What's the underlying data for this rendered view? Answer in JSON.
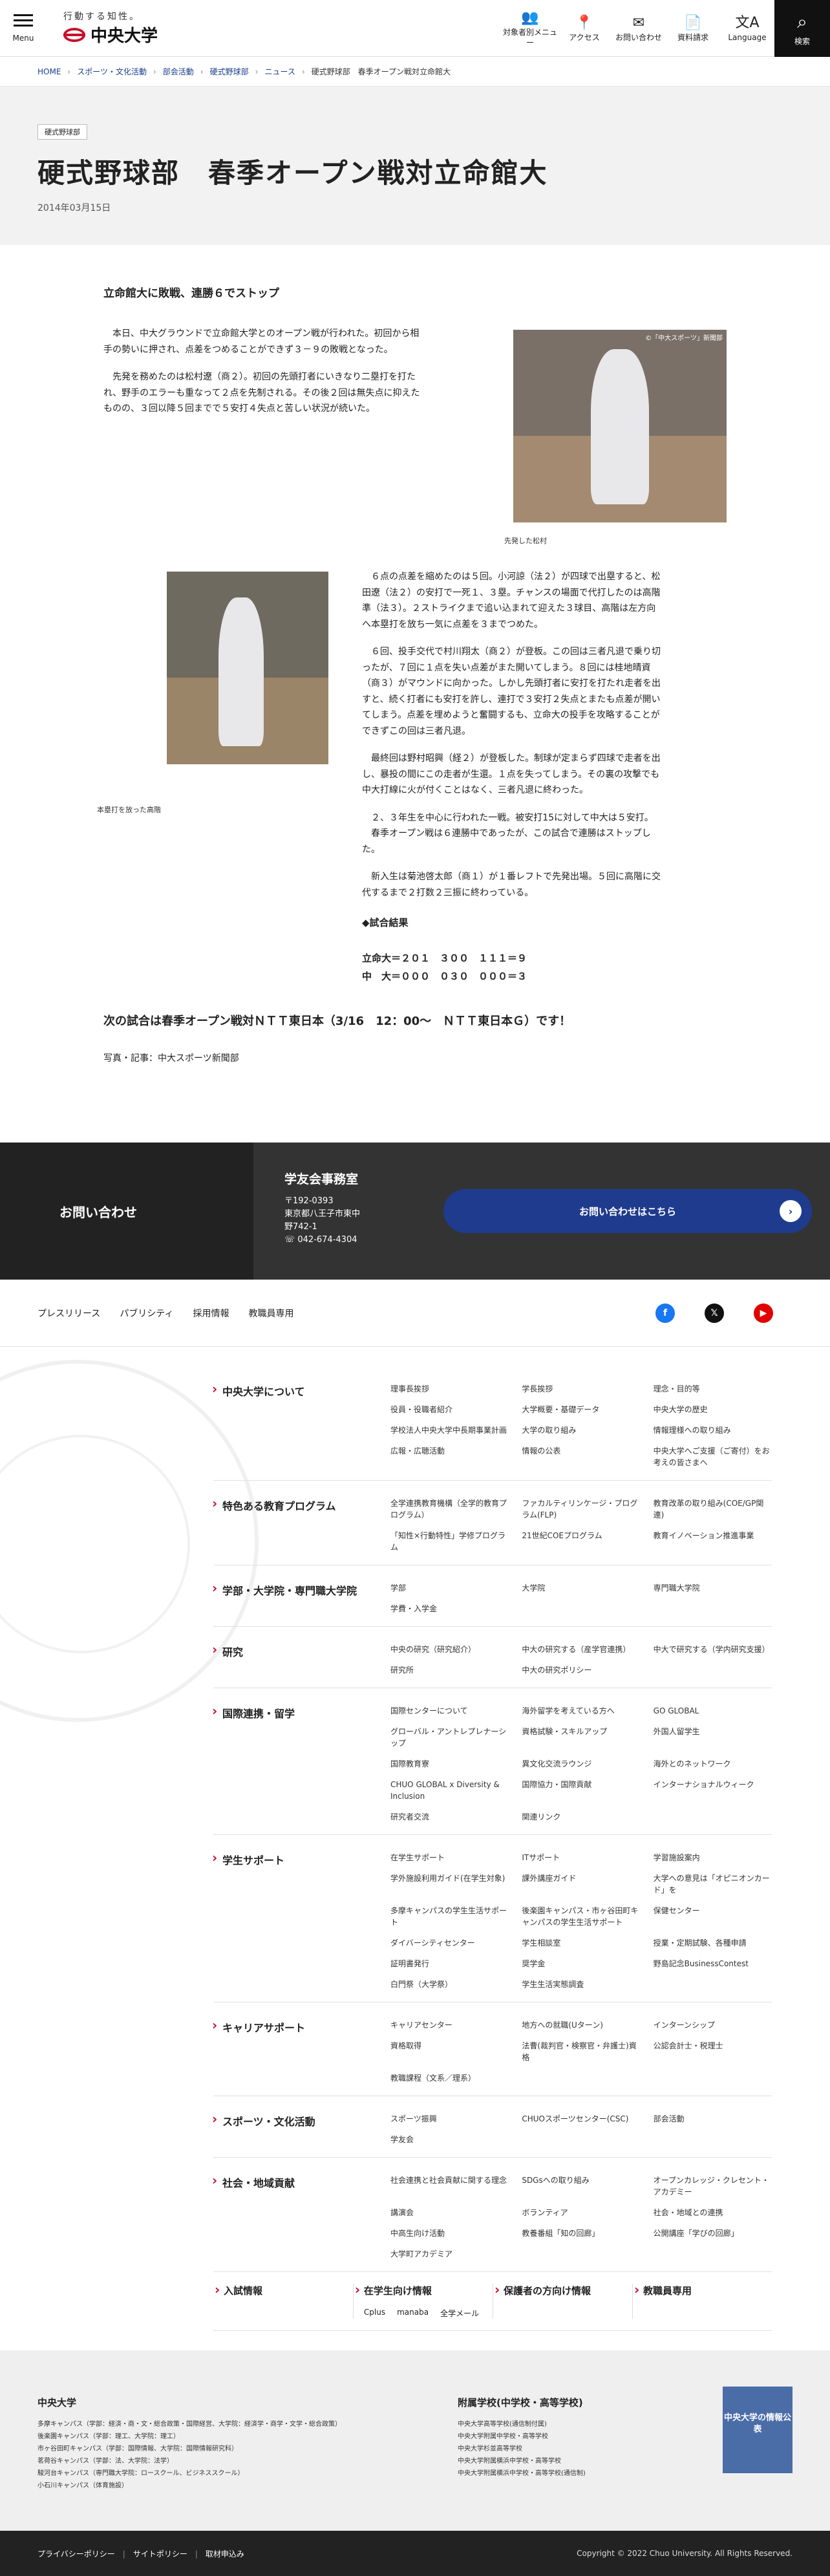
{
  "header": {
    "menu_label": "Menu",
    "logo_tagline": "行動する知性。",
    "logo_name": "中央大学",
    "nav": [
      {
        "icon": "people-icon",
        "glyph": "👥",
        "label": "対象者別メニュー"
      },
      {
        "icon": "map-pin-icon",
        "glyph": "📍",
        "label": "アクセス"
      },
      {
        "icon": "mail-icon",
        "glyph": "✉",
        "label": "お問い合わせ"
      },
      {
        "icon": "document-icon",
        "glyph": "📄",
        "label": "資料請求"
      },
      {
        "icon": "language-icon",
        "glyph": "文A",
        "label": "Language"
      }
    ],
    "search_label": "検索",
    "search_glyph": "⌕"
  },
  "breadcrumb": [
    "HOME",
    "スポーツ・文化活動",
    "部会活動",
    "硬式野球部",
    "ニュース",
    "硬式野球部　春季オープン戦対立命館大"
  ],
  "page": {
    "category": "硬式野球部",
    "title": "硬式野球部　春季オープン戦対立命館大",
    "date": "2014年03月15日"
  },
  "article": {
    "heading": "立命館大に敗戦、連勝６でストップ",
    "p1": "本日、中大グラウンドで立命館大学とのオープン戦が行われた。初回から相手の勢いに押され、点差をつめることができず３－９の敗戦となった。",
    "p2": "先発を務めたのは松村遼（商２）。初回の先頭打者にいきなり二塁打を打たれ、野手のエラーも重なって２点を先制される。その後２回は無失点に抑えたものの、３回以降５回までで５安打４失点と苦しい状況が続いた。",
    "photo1_credit": "©「中大スポーツ」新聞部",
    "photo1_caption": "先発した松村",
    "photo2_caption": "本塁打を放った高階",
    "p3": "６点の点差を縮めたのは５回。小河諒（法２）が四球で出塁すると、松田遼（法２）の安打で一死１、３塁。チャンスの場面で代打したのは高階準（法３）。２ストライクまで追い込まれて迎えた３球目、高階は左方向へ本塁打を放ち一気に点差を３までつめた。",
    "p4": "６回、投手交代で村川翔太（商２）が登板。この回は三者凡退で乗り切ったが、７回に１点を失い点差がまた開いてしまう。８回には桂地晴資（商３）がマウンドに向かった。しかし先頭打者に安打を打たれ走者を出すと、続く打者にも安打を許し、連打で３安打２失点とまたも点差が開いてしまう。点差を埋めようと奮闘するも、立命大の投手を攻略することができずこの回は三者凡退。",
    "p5": "最終回は野村昭興（経２）が登板した。制球が定まらず四球で走者を出し、暴投の間にこの走者が生還。１点を失ってしまう。その裏の攻撃でも中大打線に火が付くことはなく、三者凡退に終わった。",
    "p6a": "２、３年生を中心に行われた一戦。被安打15に対して中大は５安打。",
    "p6b": "春季オープン戦は６連勝中であったが、この試合で連勝はストップした。",
    "p7": "新入生は菊池啓太郎（商１）が１番レフトで先発出場。５回に高階に交代するまで２打数２三振に終わっている。",
    "results_title": "◆試合結果",
    "results_line1": "立命大＝２０１　３００　１１１＝９",
    "results_line2": "中　大＝０００　０３０　０００＝３",
    "next_game": "次の試合は春季オープン戦対ＮＴＴ東日本（3/16　12：00～　ＮＴＴ東日本Ｇ）です！",
    "credit": "写真・記事：中大スポーツ新聞部"
  },
  "contact": {
    "label": "お問い合わせ",
    "org": "学友会事務室",
    "postal": "〒192-0393",
    "address": "東京都八王子市東中野742-1",
    "tel": "042-674-4304",
    "button": "お問い合わせはこちら"
  },
  "sublinks": [
    "プレスリリース",
    "パブリシティ",
    "採用情報",
    "教職員専用"
  ],
  "social": [
    {
      "icon": "facebook-icon",
      "glyph": "f",
      "color": "#1877f2"
    },
    {
      "icon": "x-icon",
      "glyph": "𝕏",
      "color": "#111111"
    },
    {
      "icon": "youtube-icon",
      "glyph": "▶",
      "color": "#e00000"
    }
  ],
  "sitemap": [
    {
      "head": "中央大学について",
      "links": [
        "理事長挨拶",
        "学長挨拶",
        "理念・目的等",
        "役員・役職者紹介",
        "大学概要・基礎データ",
        "中央大学の歴史",
        "学校法人中央大学中長期事業計画",
        "大学の取り組み",
        "情報理様への取り組み",
        "広報・広聴活動",
        "情報の公表",
        "中央大学へご支援（ご寄付）をお考えの皆さまへ"
      ]
    },
    {
      "head": "特色ある教育プログラム",
      "links": [
        "全学連携教育機構（全学的教育プログラム）",
        "ファカルティリンケージ・プログラム(FLP)",
        "教育改革の取り組み(COE/GP関連)",
        "「知性×行動特性」学修プログラム",
        "21世紀COEプログラム",
        "教育イノベーション推進事業"
      ]
    },
    {
      "head": "学部・大学院・専門職大学院",
      "links": [
        "学部",
        "大学院",
        "専門職大学院",
        "学費・入学金"
      ]
    },
    {
      "head": "研究",
      "links": [
        "中央の研究（研究紹介）",
        "中大の研究する（産学官連携）",
        "中大で研究する（学内研究支援）",
        "研究所",
        "中大の研究ポリシー"
      ]
    },
    {
      "head": "国際連携・留学",
      "links": [
        "国際センターについて",
        "海外留学を考えている方へ",
        "GO GLOBAL",
        "グローバル・アントレプレナーシップ",
        "資格試験・スキルアップ",
        "外国人留学生",
        "国際教育寮",
        "異文化交流ラウンジ",
        "海外とのネットワーク",
        "CHUO GLOBAL x Diversity & Inclusion",
        "国際協力・国際貢献",
        "インターナショナルウィーク",
        "研究者交流",
        "関連リンク"
      ]
    },
    {
      "head": "学生サポート",
      "links": [
        "在学生サポート",
        "ITサポート",
        "学習施設案内",
        "学外施設利用ガイド(在学生対象)",
        "課外講座ガイド",
        "大学への意見は「オピニオンカード」を",
        "多摩キャンパスの学生生活サポート",
        "後楽園キャンパス・市ヶ谷田町キャンパスの学生生活サポート",
        "保健センター",
        "ダイバーシティセンター",
        "学生相談室",
        "授業・定期試験、各種申請",
        "証明書発行",
        "奨学金",
        "野島記念BusinessContest",
        "白門祭（大学祭）",
        "学生生活実態調査"
      ]
    },
    {
      "head": "キャリアサポート",
      "links": [
        "キャリアセンター",
        "地方への就職(Uターン)",
        "インターンシップ",
        "資格取得",
        "法曹(裁判官・検察官・弁護士)資格",
        "公認会計士・税理士",
        "教職課程（文系／理系）"
      ]
    },
    {
      "head": "スポーツ・文化活動",
      "links": [
        "スポーツ振興",
        "CHUOスポーツセンター(CSC)",
        "部会活動",
        "学友会"
      ]
    },
    {
      "head": "社会・地域貢献",
      "links": [
        "社会連携と社会貢献に関する理念",
        "SDGsへの取り組み",
        "オープンカレッジ・クレセント・アカデミー",
        "講演会",
        "ボランティア",
        "社会・地域との連携",
        "中高生向け活動",
        "教養番組「知の回廊」",
        "公開講座「学びの回廊」",
        "大学町アカデミア"
      ]
    }
  ],
  "quick": [
    {
      "head": "入試情報",
      "subs": []
    },
    {
      "head": "在学生向け情報",
      "subs": [
        "Cplus",
        "manaba",
        "全学メール"
      ]
    },
    {
      "head": "保護者の方向け情報",
      "subs": []
    },
    {
      "head": "教職員専用",
      "subs": []
    }
  ],
  "schools": {
    "univ_title": "中央大学",
    "univ_lines": [
      "多摩キャンパス（学部：経済・商・文・総合政策・国際経営、大学院：経済学・商学・文学・総合政策）",
      "後楽園キャンパス（学部：理工、大学院：理工）",
      "市ヶ谷田町キャンパス（学部：国際情報、大学院：国際情報研究科）",
      "茗荷谷キャンパス（学部：法、大学院：法学）",
      "駿河台キャンパス（専門職大学院：ロースクール、ビジネススクール）",
      "小石川キャンパス（体育施設）"
    ],
    "assoc_title": "附属学校(中学校・高等学校)",
    "assoc_lines": [
      "中央大学高等学校(通信制付属)",
      "中央大学附属中学校・高等学校",
      "中央大学杉並高等学校",
      "中央大学附属横浜中学校・高等学校",
      "中央大学附属横浜中学校・高等学校(通信制)"
    ],
    "banner": "中央大学の情報公表"
  },
  "footer": {
    "links": [
      "プライバシーポリシー",
      "サイトポリシー",
      "取材申込み"
    ],
    "copyright": "Copyright © 2022 Chuo University. All Rights Reserved."
  },
  "colors": {
    "brand_red": "#c8102e",
    "primary_blue": "#1f3b8d"
  }
}
